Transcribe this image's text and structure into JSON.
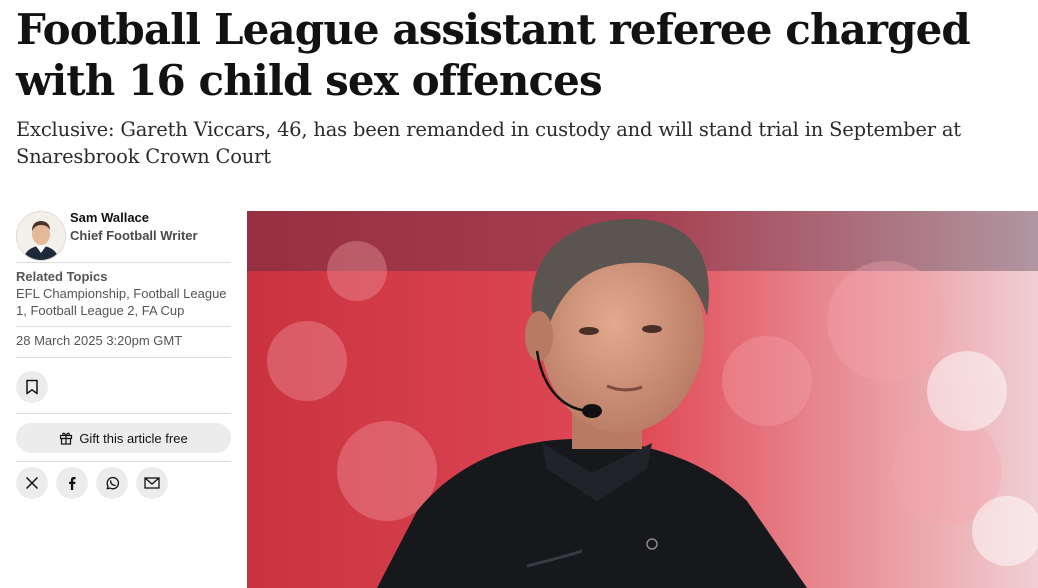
{
  "article": {
    "headline": "Football League assistant referee charged with 16 child sex offences",
    "standfirst": "Exclusive: Gareth Viccars, 46, has been remanded in custody and will stand trial in September at Snaresbrook Crown Court"
  },
  "author": {
    "name": "Sam Wallace",
    "role": "Chief Football Writer"
  },
  "topics": {
    "label": "Related Topics",
    "list": "EFL Championship, Football League 1, Football League 2, FA Cup"
  },
  "meta": {
    "date": "28 March 2025 3:20pm GMT"
  },
  "actions": {
    "gift_label": "Gift this article free",
    "share_icons": [
      "x-icon",
      "facebook-icon",
      "whatsapp-icon",
      "email-icon"
    ]
  },
  "colors": {
    "button_bg": "#ececec",
    "photo_background": "#d9404c"
  }
}
